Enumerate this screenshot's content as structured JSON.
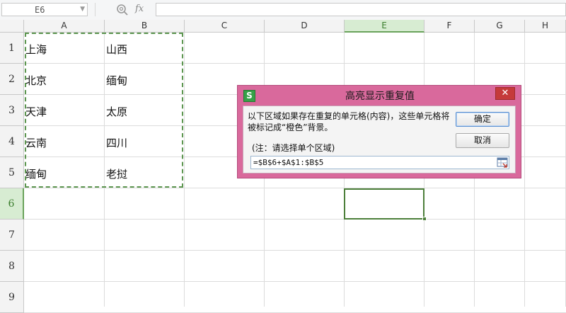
{
  "formula_bar": {
    "cell_ref": "E6",
    "fx": "fx",
    "formula": ""
  },
  "columns": [
    {
      "label": "A"
    },
    {
      "label": "B"
    },
    {
      "label": "C"
    },
    {
      "label": "D"
    },
    {
      "label": "E",
      "active": true
    },
    {
      "label": "F"
    },
    {
      "label": "G"
    },
    {
      "label": "H"
    }
  ],
  "rows": [
    {
      "label": "1"
    },
    {
      "label": "2"
    },
    {
      "label": "3"
    },
    {
      "label": "4"
    },
    {
      "label": "5"
    },
    {
      "label": "6",
      "active": true
    },
    {
      "label": "7"
    },
    {
      "label": "8"
    },
    {
      "label": "9"
    }
  ],
  "cells": [
    {
      "ref": "A1",
      "value": "上海"
    },
    {
      "ref": "B1",
      "value": "山西"
    },
    {
      "ref": "A2",
      "value": "北京"
    },
    {
      "ref": "B2",
      "value": "缅甸"
    },
    {
      "ref": "A3",
      "value": "天津"
    },
    {
      "ref": "B3",
      "value": "太原"
    },
    {
      "ref": "A4",
      "value": "云南"
    },
    {
      "ref": "B4",
      "value": "四川"
    },
    {
      "ref": "A5",
      "value": "缅甸"
    },
    {
      "ref": "B5",
      "value": "老挝"
    }
  ],
  "dialog": {
    "title": "高亮显示重复值",
    "app_icon": "S",
    "close_symbol": "✕",
    "message": "以下区域如果存在重复的单元格(内容)，这些单元格将被标记成“橙色”背景。",
    "note": "(注：请选择单个区域)",
    "range_value": "=$B$6+$A$1:$B$5",
    "ok_label": "确定",
    "cancel_label": "取消"
  },
  "colors": {
    "dialog_frame": "#d9699c",
    "selection_border": "#5d9650",
    "active_header": "#d7ecd2",
    "close_button": "#c53a3a"
  }
}
